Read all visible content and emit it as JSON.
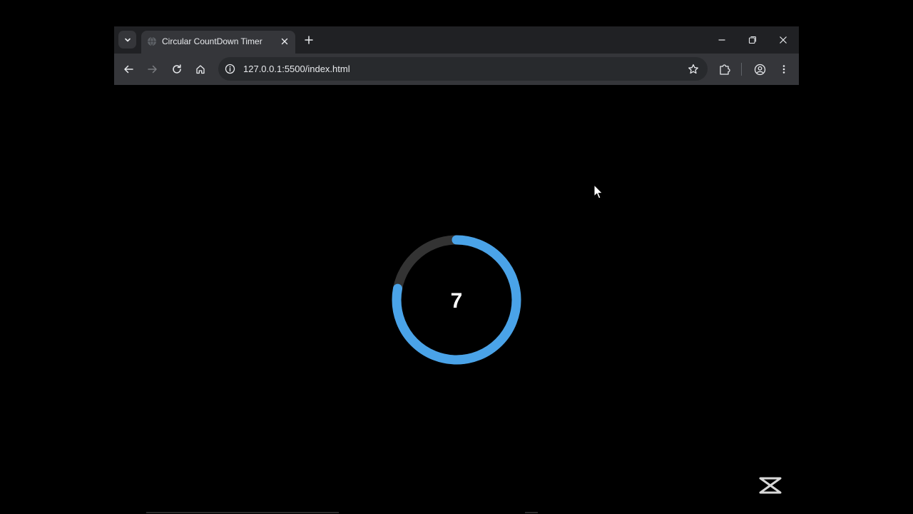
{
  "browser": {
    "tab": {
      "title": "Circular CountDown Timer"
    },
    "omnibox": {
      "url": "127.0.0.1:5500/index.html"
    }
  },
  "page": {
    "timer": {
      "value": "7",
      "progress_fraction": 0.78,
      "track_color": "#333333",
      "progress_color": "#4aa3e8"
    }
  },
  "icons": {
    "tab_search": "chevron-down-icon",
    "favicon": "globe-icon",
    "tab_close": "close-icon",
    "new_tab": "plus-icon",
    "minimize": "minimize-icon",
    "restore": "restore-icon",
    "close_window": "close-icon",
    "back": "arrow-left-icon",
    "forward": "arrow-right-icon",
    "reload": "reload-icon",
    "home": "home-icon",
    "site_info": "info-icon",
    "bookmark": "star-icon",
    "extensions": "puzzle-icon",
    "profile": "account-circle-icon",
    "menu": "more-vertical-icon",
    "watermark": "capcut-logo-icon"
  }
}
